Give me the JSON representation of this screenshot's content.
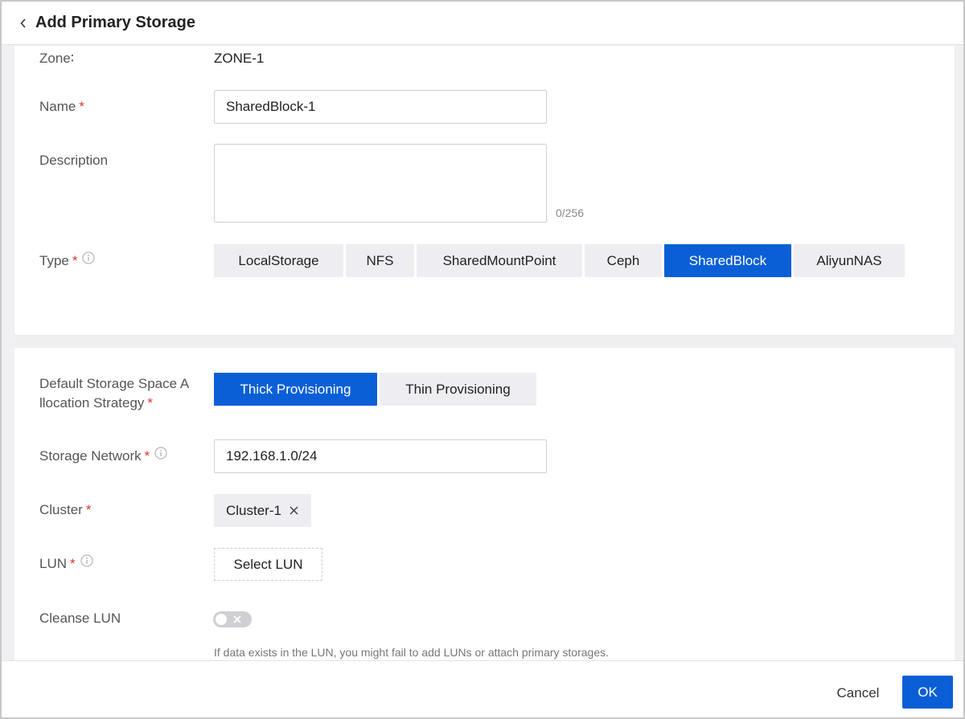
{
  "header": {
    "title": "Add Primary Storage",
    "back_icon": "chevron-left-icon"
  },
  "basic": {
    "zone_label": "Zone∶",
    "zone_value": "ZONE-1",
    "name_label": "Name",
    "name_value": "SharedBlock-1",
    "description_label": "Description",
    "description_value": "",
    "description_counter": "0/256",
    "type_label": "Type",
    "type_options": [
      "LocalStorage",
      "NFS",
      "SharedMountPoint",
      "Ceph",
      "SharedBlock",
      "AliyunNAS"
    ],
    "type_selected": "SharedBlock"
  },
  "shared_block": {
    "strategy_label_line1": "Default Storage Space A",
    "strategy_label_line2": "llocation Strategy",
    "strategy_options": [
      "Thick Provisioning",
      "Thin Provisioning"
    ],
    "strategy_selected": "Thick Provisioning",
    "network_label": "Storage Network",
    "network_value": "192.168.1.0/24",
    "cluster_label": "Cluster",
    "cluster_tag": "Cluster-1",
    "lun_label": "LUN",
    "lun_button": "Select LUN",
    "cleanse_label": "Cleanse LUN",
    "cleanse_enabled": false,
    "cleanse_hint": "If data exists in the LUN, you might fail to add LUNs or attach primary storages."
  },
  "footer": {
    "cancel_label": "Cancel",
    "ok_label": "OK"
  },
  "colors": {
    "primary": "#0a5fd6",
    "required": "#e0342b",
    "segment_bg": "#eeeef2"
  },
  "required_mark": "*"
}
